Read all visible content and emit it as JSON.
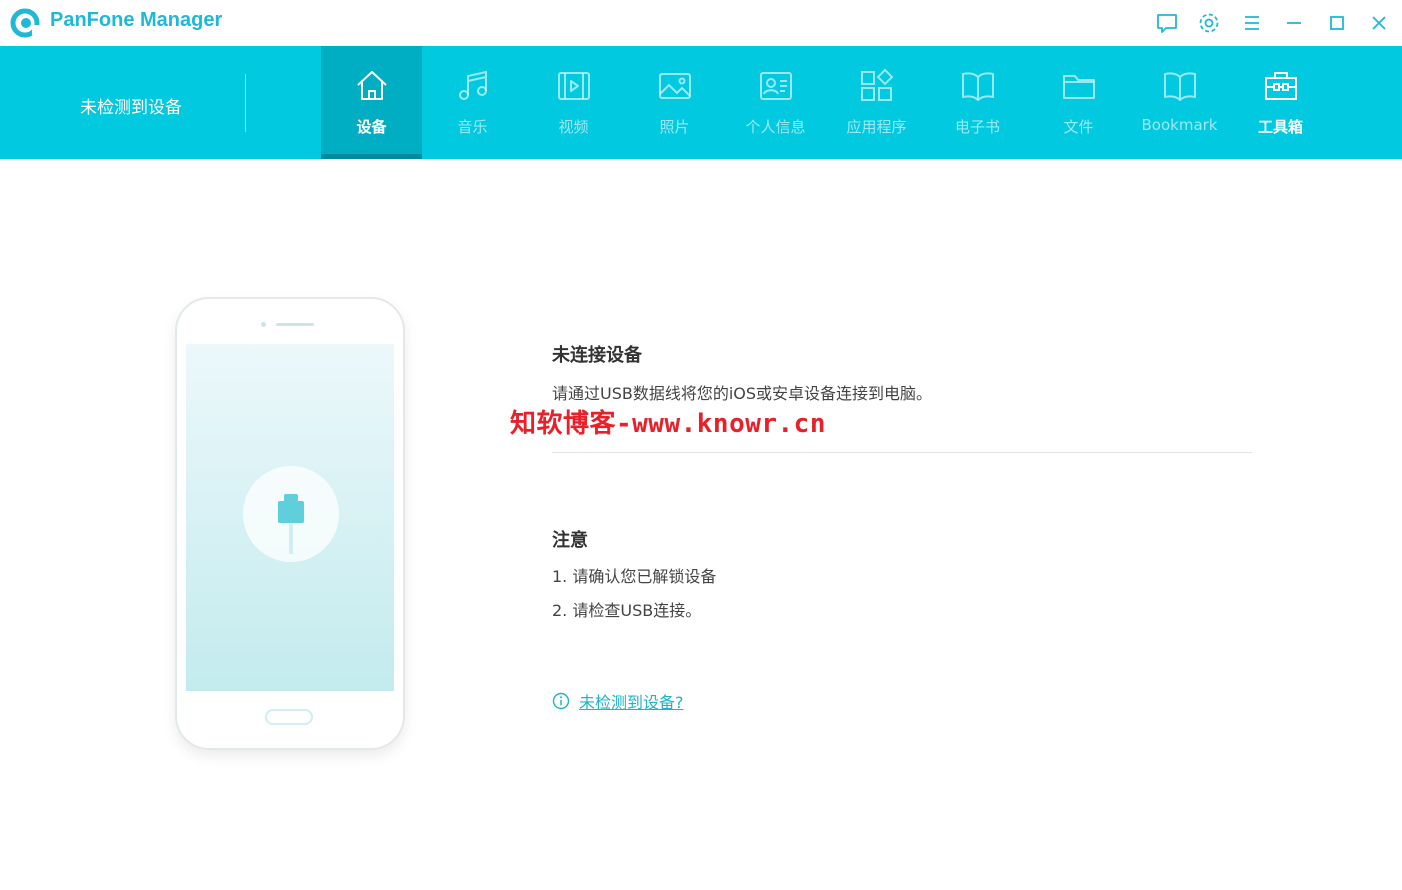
{
  "app": {
    "title": "PanFone Manager"
  },
  "navbar": {
    "device_status": "未检测到设备",
    "tabs": [
      {
        "label": "设备",
        "icon": "home-icon",
        "active": true
      },
      {
        "label": "音乐",
        "icon": "music-icon"
      },
      {
        "label": "视频",
        "icon": "video-icon"
      },
      {
        "label": "照片",
        "icon": "photo-icon"
      },
      {
        "label": "个人信息",
        "icon": "contact-card-icon"
      },
      {
        "label": "应用程序",
        "icon": "apps-icon"
      },
      {
        "label": "电子书",
        "icon": "book-icon"
      },
      {
        "label": "文件",
        "icon": "folder-icon"
      },
      {
        "label": "Bookmark",
        "icon": "bookmark-book-icon"
      },
      {
        "label": "工具箱",
        "icon": "toolbox-icon"
      }
    ]
  },
  "main": {
    "title": "未连接设备",
    "description": "请通过USB数据线将您的iOS或安卓设备连接到电脑。",
    "watermark": "知软博客-www.knowr.cn",
    "note_title": "注意",
    "notes": [
      "1. 请确认您已解锁设备",
      "2. 请检查USB连接。"
    ],
    "help_link": "未检测到设备?"
  },
  "colors": {
    "accent": "#00c9e0",
    "active_tab": "#00aec4",
    "link": "#1fb3cc",
    "watermark": "#e8202a"
  }
}
